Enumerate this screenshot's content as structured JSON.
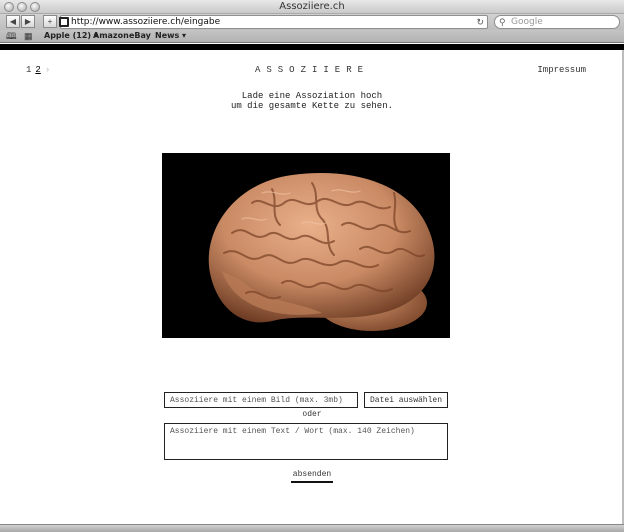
{
  "window": {
    "title": "Assoziiere.ch"
  },
  "toolbar": {
    "back_glyph": "◀",
    "forward_glyph": "▶",
    "add_glyph": "+",
    "url": "http://www.assoziiere.ch/eingabe",
    "reload_glyph": "↻",
    "search_placeholder": "Google",
    "search_glyph": "⚲"
  },
  "bookmarks": {
    "book_glyph": "🕮",
    "grid_glyph": "▦",
    "items": [
      "Apple (12) ▾",
      "Amazon",
      "eBay",
      "News ▾"
    ]
  },
  "pager": {
    "pages": [
      "1",
      "2"
    ],
    "next_glyph": "›"
  },
  "header": {
    "title": "ASSOZIIERE",
    "impressum": "Impressum"
  },
  "intro": {
    "line1": "Lade eine Assoziation hoch",
    "line2": "um die gesamte Kette zu sehen."
  },
  "form": {
    "image_placeholder": "Assoziiere mit einem Bild (max. 3mb)",
    "file_button": "Datei auswählen",
    "or_label": "oder",
    "text_placeholder": "Assoziiere mit einem Text / Wort (max. 140 Zeichen)",
    "submit_label": "absenden"
  },
  "colors": {
    "page_bg": "#ffffff",
    "band": "#000000",
    "brain": "#c98a64"
  }
}
